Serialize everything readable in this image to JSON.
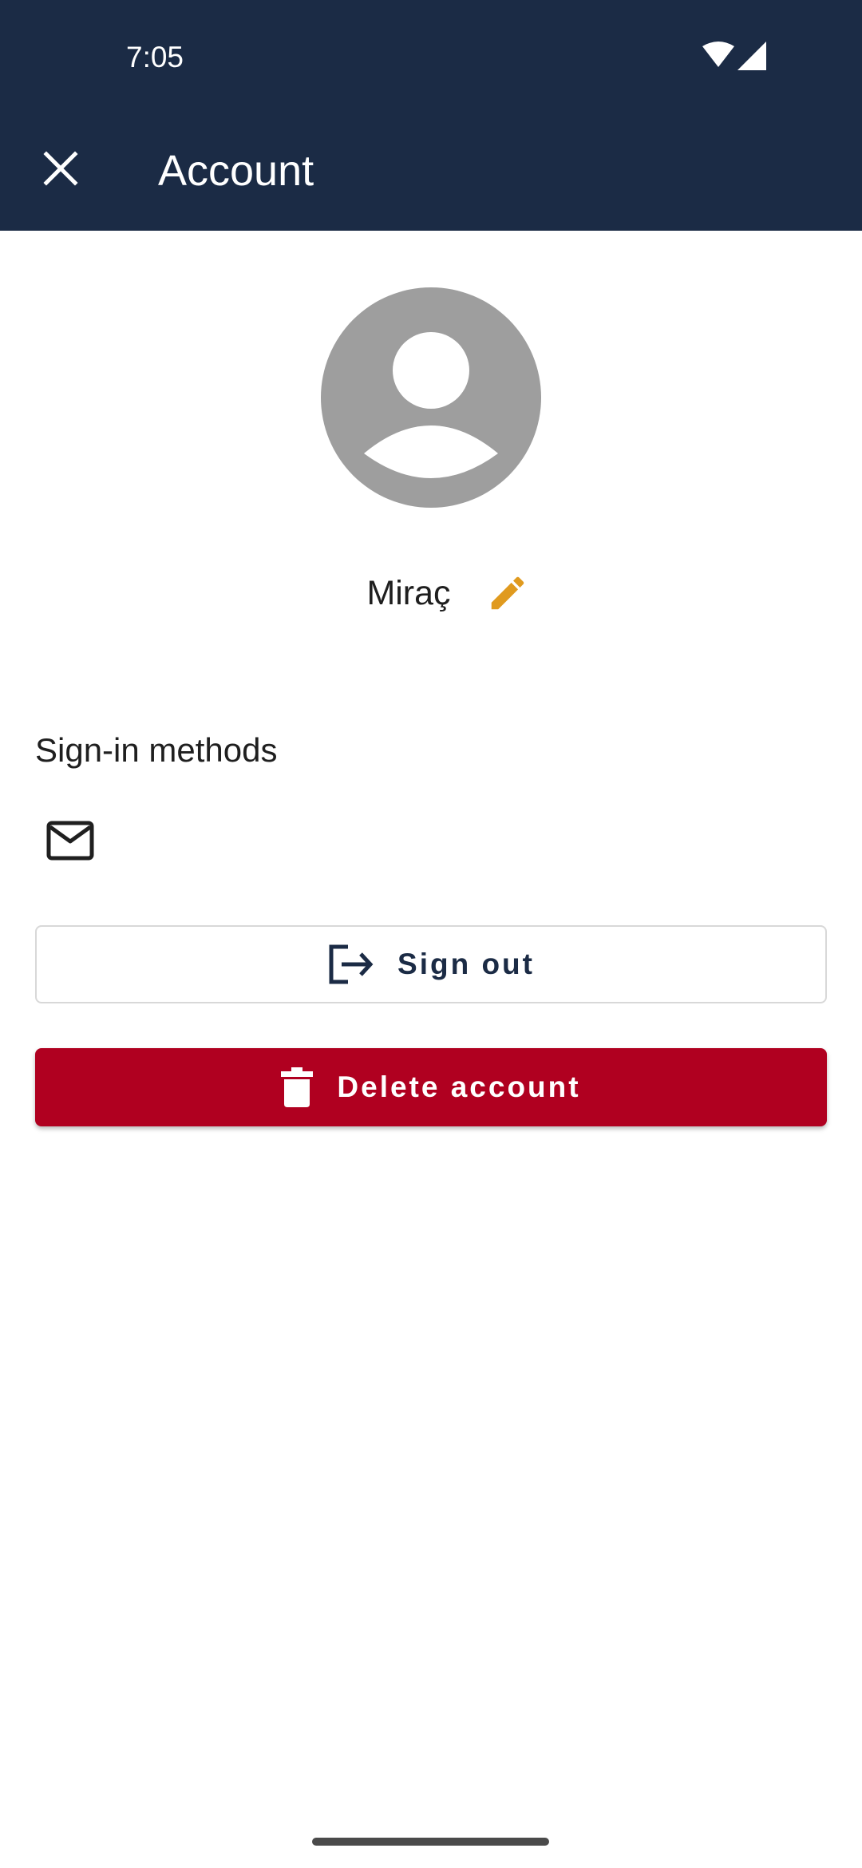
{
  "status_bar": {
    "time": "7:05",
    "icons": [
      "wifi-icon",
      "cellular-signal-icon"
    ]
  },
  "app_bar": {
    "title": "Account",
    "close_icon": "close-icon",
    "background": "#1b2b45"
  },
  "profile": {
    "avatar_icon": "account-circle-icon",
    "name": "Miraç",
    "edit_icon": "pencil-icon",
    "edit_color": "#e09a1e"
  },
  "sign_in_methods": {
    "title": "Sign-in methods",
    "methods": [
      {
        "icon": "email-icon"
      }
    ]
  },
  "actions": {
    "sign_out_label": "Sign out",
    "sign_out_icon": "logout-icon",
    "delete_label": "Delete account",
    "delete_icon": "trash-icon",
    "delete_color": "#b00020"
  }
}
